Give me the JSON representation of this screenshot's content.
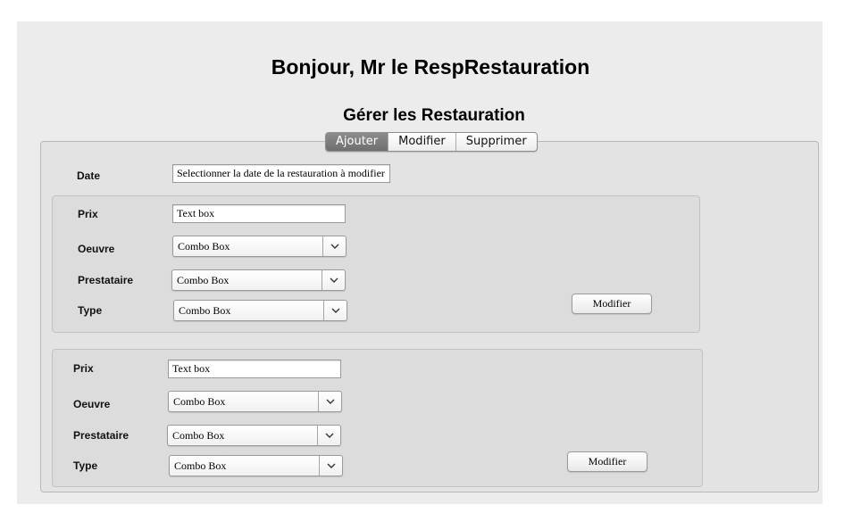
{
  "header": {
    "title": "Bonjour, Mr le RespRestauration",
    "subtitle": "Gérer les Restauration"
  },
  "tabs": [
    {
      "label": "Ajouter",
      "active": true
    },
    {
      "label": "Modifier",
      "active": false
    },
    {
      "label": "Supprimer",
      "active": false
    }
  ],
  "form": {
    "date_label": "Date",
    "date_field": "Selectionner la date de la restauration à modifier"
  },
  "groups": [
    {
      "prix_label": "Prix",
      "prix_value": "Text box",
      "oeuvre_label": "Oeuvre",
      "oeuvre_value": "Combo Box",
      "prestataire_label": "Prestataire",
      "prestataire_value": "Combo Box",
      "type_label": "Type",
      "type_value": "Combo Box",
      "button_label": "Modifier"
    },
    {
      "prix_label": "Prix",
      "prix_value": "Text box",
      "oeuvre_label": "Oeuvre",
      "oeuvre_value": "Combo Box",
      "prestataire_label": "Prestataire",
      "prestataire_value": "Combo Box",
      "type_label": "Type",
      "type_value": "Combo Box",
      "button_label": "Modifier"
    }
  ],
  "icons": {
    "combo_arrow": "chevron-down-icon"
  },
  "colors": {
    "window_bg": "#ececec",
    "tab_active_bg": "#7d7d7d",
    "tab_active_text": "#ffffff"
  }
}
